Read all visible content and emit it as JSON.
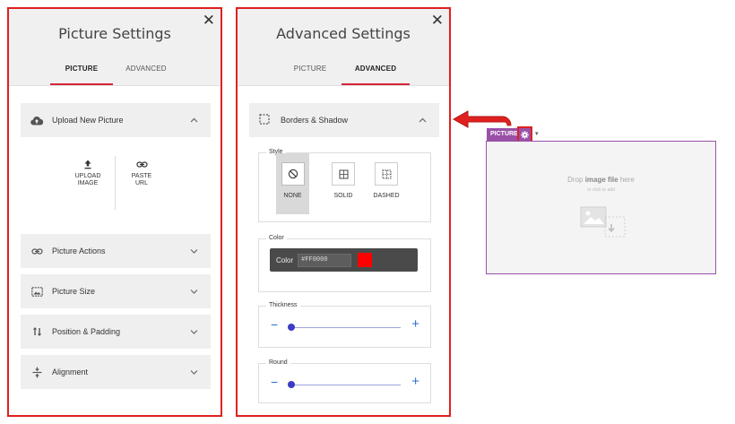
{
  "picture_settings": {
    "title": "Picture Settings",
    "close": "✕",
    "tabs": [
      {
        "label": "PICTURE",
        "active": true
      },
      {
        "label": "ADVANCED",
        "active": false
      }
    ],
    "sections": [
      {
        "label": "Upload New Picture",
        "icon": "cloud-upload-icon",
        "expanded": true
      },
      {
        "label": "Picture Actions",
        "icon": "link-icon",
        "expanded": false
      },
      {
        "label": "Picture Size",
        "icon": "image-size-icon",
        "expanded": false
      },
      {
        "label": "Position & Padding",
        "icon": "arrows-updown-icon",
        "expanded": false
      },
      {
        "label": "Alignment",
        "icon": "align-vertical-icon",
        "expanded": false
      }
    ],
    "upload": {
      "upload_label_1": "UPLOAD",
      "upload_label_2": "IMAGE",
      "paste_label_1": "PASTE",
      "paste_label_2": "URL"
    }
  },
  "advanced_settings": {
    "title": "Advanced Settings",
    "close": "✕",
    "tabs": [
      {
        "label": "PICTURE",
        "active": false
      },
      {
        "label": "ADVANCED",
        "active": true
      }
    ],
    "section": {
      "label": "Borders & Shadow",
      "icon": "border-dashed-icon",
      "expanded": true
    },
    "style": {
      "legend": "Style",
      "options": [
        {
          "label": "NONE",
          "icon": "none-icon",
          "selected": true
        },
        {
          "label": "SOLID",
          "icon": "border-solid-icon",
          "selected": false
        },
        {
          "label": "DASHED",
          "icon": "border-dashed-icon",
          "selected": false
        }
      ]
    },
    "color": {
      "legend": "Color",
      "label": "Color",
      "value": "#FF0000",
      "swatch": "#ff0000"
    },
    "thickness": {
      "legend": "Thickness",
      "minus": "−",
      "plus": "+"
    },
    "round": {
      "legend": "Round",
      "minus": "−",
      "plus": "+"
    }
  },
  "widget": {
    "chip_label": "PICTURE",
    "caret": "▾",
    "drop_prefix": "Drop ",
    "drop_bold": "image file",
    "drop_suffix": " here",
    "drop_sub": "or click to add",
    "accent": "#9a50a8"
  },
  "colors": {
    "highlight": "#e02020",
    "tab_active": "#d6253b",
    "slider": "#3c3cc4"
  }
}
